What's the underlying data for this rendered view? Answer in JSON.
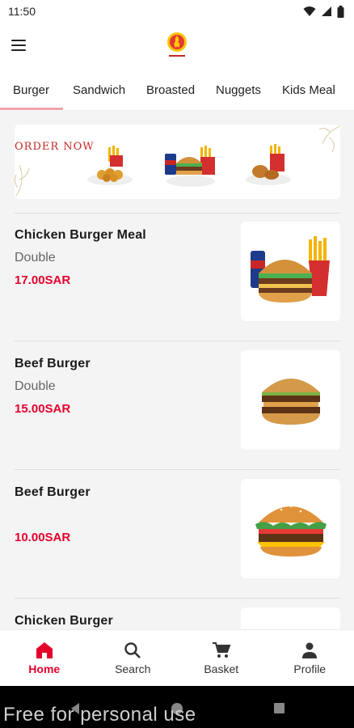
{
  "status": {
    "time": "11:50"
  },
  "tabs": [
    {
      "label": "Burger"
    },
    {
      "label": "Sandwich"
    },
    {
      "label": "Broasted"
    },
    {
      "label": "Nuggets"
    },
    {
      "label": "Kids Meal"
    }
  ],
  "banner": {
    "text": "ORDER NOW"
  },
  "items": [
    {
      "name": "Chicken Burger Meal",
      "desc": "Double",
      "price": "17.00SAR"
    },
    {
      "name": "Beef Burger",
      "desc": "Double",
      "price": "15.00SAR"
    },
    {
      "name": "Beef Burger",
      "desc": "",
      "price": "10.00SAR"
    },
    {
      "name": "Chicken Burger",
      "desc": "",
      "price": ""
    }
  ],
  "nav": [
    {
      "label": "Home",
      "icon": "home-icon"
    },
    {
      "label": "Search",
      "icon": "search-icon"
    },
    {
      "label": "Basket",
      "icon": "cart-icon"
    },
    {
      "label": "Profile",
      "icon": "person-icon"
    }
  ],
  "watermark": "Free for personal use",
  "colors": {
    "accent": "#e5002b",
    "tab_indicator": "#f2a5ac"
  }
}
